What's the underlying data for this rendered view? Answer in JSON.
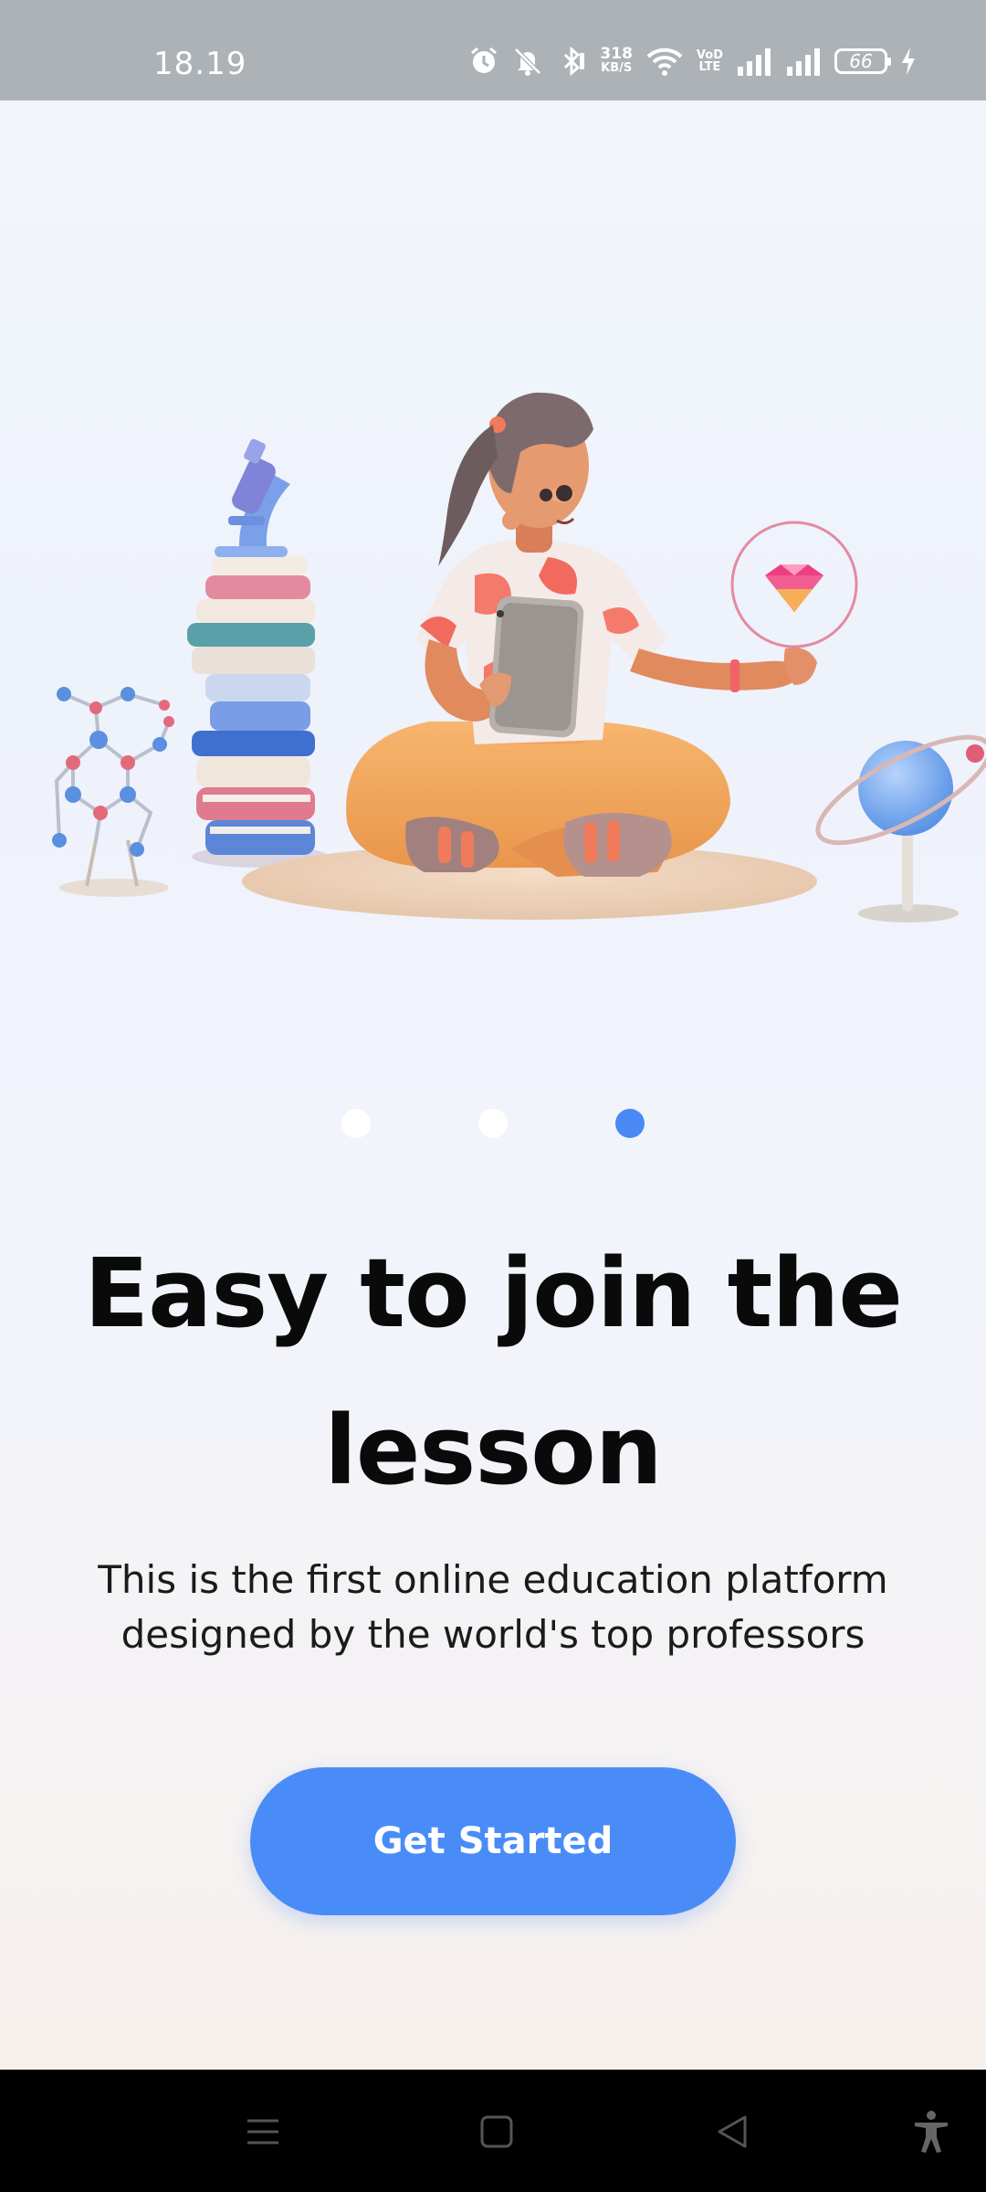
{
  "status_bar": {
    "time": "18.19",
    "net_speed_value": "318",
    "net_speed_unit": "KB/S",
    "volte_top": "VoD",
    "volte_bottom": "LTE",
    "battery": "66"
  },
  "pager": {
    "total": 3,
    "active_index": 2,
    "active_color": "#4a89f3"
  },
  "onboarding": {
    "title": "Easy to join the lesson",
    "subtitle": "This is the first online education platform designed by the world's top professors",
    "cta_label": "Get Started",
    "accent": "#4a8cf7"
  },
  "nav": {
    "icons": [
      "menu-icon",
      "home-icon",
      "back-icon",
      "accessibility-icon"
    ]
  }
}
